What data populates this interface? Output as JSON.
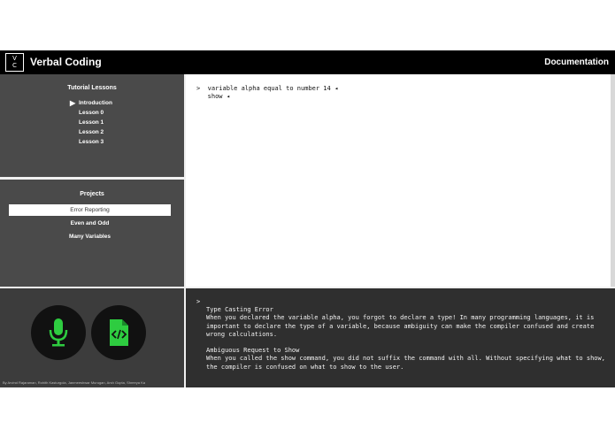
{
  "header": {
    "logo_top": "V",
    "logo_bottom": "C",
    "title": "Verbal Coding",
    "documentation_link": "Documentation"
  },
  "lessons": {
    "title": "Tutorial Lessons",
    "items": [
      "Introduction",
      "Lesson 0",
      "Lesson 1",
      "Lesson 2",
      "Lesson 3"
    ],
    "active_arrow": "▶"
  },
  "projects": {
    "title": "Projects",
    "items": [
      "Error Reporting",
      "Even and Odd",
      "Many Variables"
    ]
  },
  "controls": {
    "mic_icon": "microphone-icon",
    "file_icon": "code-file-icon",
    "accent_color": "#2ecc40",
    "credits": "By Arvind Rajaraman, Rohith Kasturgola, Janmeeshwar Murugan, Arsh Gupta, Shreeya Ka"
  },
  "editor": {
    "prompt": ">",
    "lines": [
      "variable alpha equal to number 14 ◂",
      "show ◂"
    ]
  },
  "output": {
    "prompt": ">",
    "errors": [
      {
        "title": "Type Casting Error",
        "lines": [
          "When you declared the variable alpha, you forgot to declare a type! In many programming languages, it is",
          "important to declare the type of a variable, because ambiguity can make the compiler confused and create",
          "wrong calculations."
        ]
      },
      {
        "title": "Ambiguous Request to Show",
        "lines": [
          "When you called the show command, you did not suffix the command with all. Without specifying what to show,",
          "the compiler is confused on what to show to the user."
        ]
      }
    ]
  }
}
